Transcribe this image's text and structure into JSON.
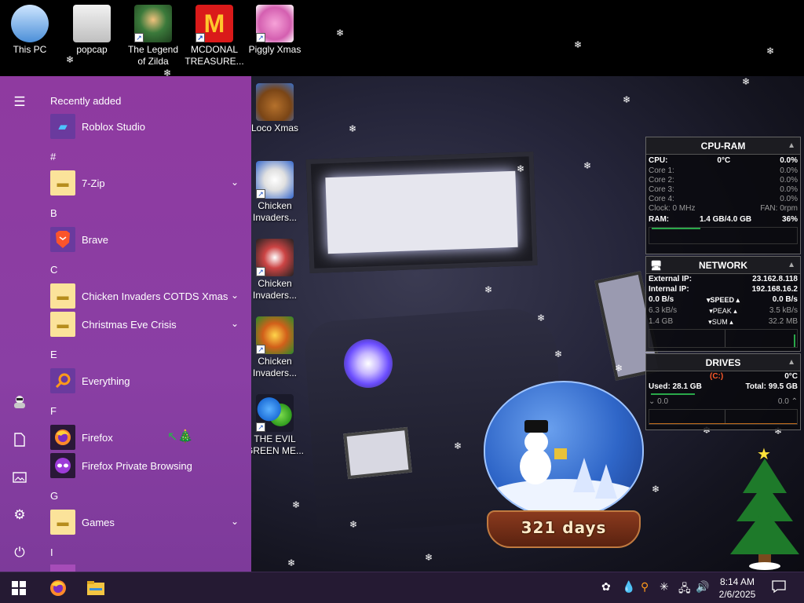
{
  "desktop_icons": [
    {
      "label": "This PC",
      "icon": "monitor-icon"
    },
    {
      "label": "popcap",
      "icon": "folder-icon"
    },
    {
      "label": "The Legend of Zilda",
      "icon": "game-character-icon"
    },
    {
      "label": "MCDONAL TREASURE...",
      "icon": "mcdonalds-logo-icon"
    },
    {
      "label": "Piggly Xmas",
      "icon": "pig-icon"
    },
    {
      "label": "Loco Xmas",
      "icon": "bear-santa-icon"
    },
    {
      "label": "Chicken Invaders...",
      "icon": "chicken-icon"
    },
    {
      "label": "Chicken Invaders...",
      "icon": "chicken-icon"
    },
    {
      "label": "Chicken Invaders...",
      "icon": "chicken-icon"
    },
    {
      "label": "THE EVIL GREEN ME...",
      "icon": "messenger-icon"
    }
  ],
  "start_menu": {
    "recently_added_title": "Recently added",
    "sections": [
      "#",
      "B",
      "C",
      "E",
      "F",
      "G",
      "I"
    ],
    "apps": [
      {
        "name": "Roblox Studio",
        "icon": "roblox-studio-icon"
      },
      {
        "name": "7-Zip",
        "icon": "folder-icon",
        "expandable": true
      },
      {
        "name": "Brave",
        "icon": "brave-lion-icon"
      },
      {
        "name": "Chicken Invaders COTDS Xmas",
        "icon": "folder-icon",
        "expandable": true
      },
      {
        "name": "Christmas Eve Crisis",
        "icon": "folder-icon",
        "expandable": true
      },
      {
        "name": "Everything",
        "icon": "magnifier-icon"
      },
      {
        "name": "Firefox",
        "icon": "firefox-icon"
      },
      {
        "name": "Firefox Private Browsing",
        "icon": "private-mask-icon"
      },
      {
        "name": "Games",
        "icon": "folder-icon",
        "expandable": true
      }
    ],
    "rail_icons": [
      "hamburger-menu-icon",
      "user-avatar-icon",
      "document-icon",
      "pictures-icon",
      "settings-gear-icon",
      "power-icon"
    ]
  },
  "cpu_ram": {
    "title": "CPU-RAM",
    "cpu_label": "CPU:",
    "cpu_temp": "0°C",
    "cpu_pct": "0.0%",
    "cores": [
      {
        "label": "Core 1:",
        "value": "0.0%"
      },
      {
        "label": "Core 2:",
        "value": "0.0%"
      },
      {
        "label": "Core 3:",
        "value": "0.0%"
      },
      {
        "label": "Core 4:",
        "value": "0.0%"
      }
    ],
    "clock_label": "Clock: 0 MHz",
    "fan_label": "FAN: 0rpm",
    "ram_label": "RAM:",
    "ram_value": "1.4 GB/4.0 GB",
    "ram_pct": "36%"
  },
  "network": {
    "title": "NETWORK",
    "external_ip_label": "External IP:",
    "external_ip": "23.162.8.118",
    "internal_ip_label": "Internal IP:",
    "internal_ip": "192.168.16.2",
    "rows": [
      {
        "left": "0.0 B/s",
        "mid": "▾SPEED ▴",
        "right": "0.0 B/s"
      },
      {
        "left": "6.3 kB/s",
        "mid": "▾PEAK ▴",
        "right": "3.5 kB/s"
      },
      {
        "left": "1.4 GB",
        "mid": "▾SUM ▴",
        "right": "32.2 MB"
      }
    ]
  },
  "drives": {
    "title": "DRIVES",
    "drive_label": "(C:)",
    "drive_temp": "0°C",
    "used": "Used: 28.1 GB",
    "total": "Total: 99.5 GB",
    "read": "0.0",
    "write": "0.0"
  },
  "snow_globe": {
    "countdown": "321 days"
  },
  "taskbar": {
    "pinned": [
      {
        "name": "Firefox",
        "icon": "firefox-icon"
      },
      {
        "name": "File Explorer",
        "icon": "file-explorer-icon"
      }
    ],
    "tray_icons": [
      "colorful-app-icon",
      "drop-icon",
      "search-magnifier-icon",
      "snowflake-icon",
      "network-icon",
      "volume-icon"
    ],
    "time": "8:14 AM",
    "date": "2/6/2025"
  }
}
